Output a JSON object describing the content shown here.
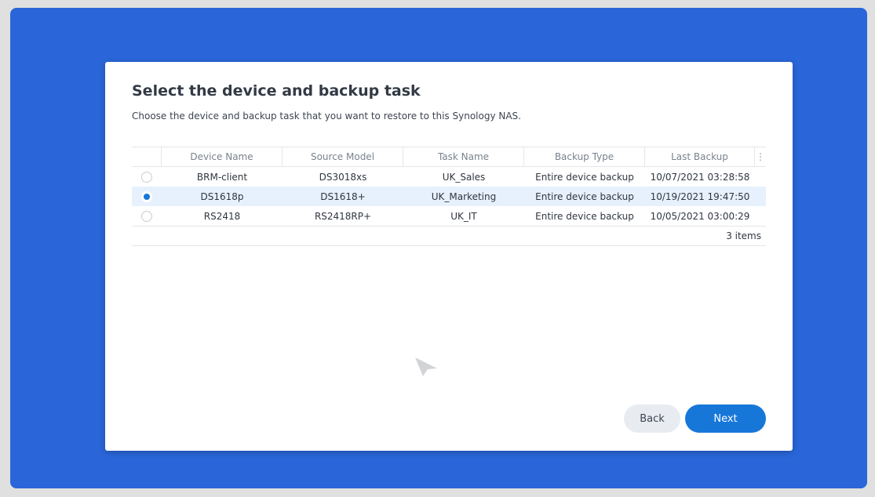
{
  "dialog": {
    "title": "Select the device and backup task",
    "subtitle": "Choose the device and backup task that you want to restore to this Synology NAS."
  },
  "table": {
    "columns": [
      "Device Name",
      "Source Model",
      "Task Name",
      "Backup Type",
      "Last Backup"
    ],
    "menu_icon": "⋮",
    "rows": [
      {
        "device": "BRM-client",
        "model": "DS3018xs",
        "task": "UK_Sales",
        "type": "Entire device backup",
        "last": "10/07/2021 03:28:58",
        "selected": false
      },
      {
        "device": "DS1618p",
        "model": "DS1618+",
        "task": "UK_Marketing",
        "type": "Entire device backup",
        "last": "10/19/2021 19:47:50",
        "selected": true
      },
      {
        "device": "RS2418",
        "model": "RS2418RP+",
        "task": "UK_IT",
        "type": "Entire device backup",
        "last": "10/05/2021 03:00:29",
        "selected": false
      }
    ],
    "count": "3 items"
  },
  "buttons": {
    "back": "Back",
    "next": "Next"
  },
  "colors": {
    "desktop": "#2a66d9",
    "accent": "#1677d9",
    "selected_row": "#e6f1fd"
  }
}
